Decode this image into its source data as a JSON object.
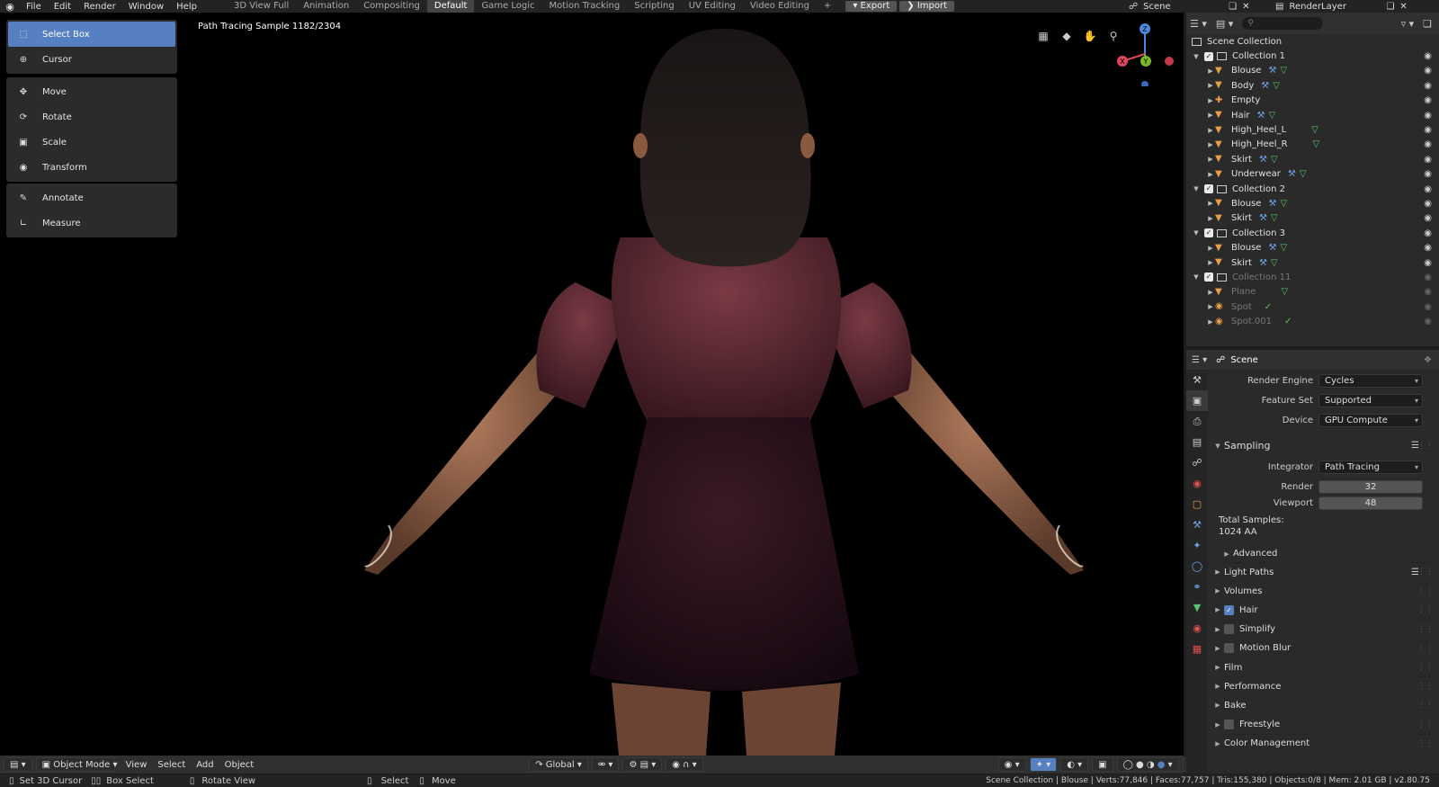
{
  "menu": [
    "File",
    "Edit",
    "Render",
    "Window",
    "Help"
  ],
  "workspaces": [
    "3D View Full",
    "Animation",
    "Compositing",
    "Default",
    "Game Logic",
    "Motion Tracking",
    "Scripting",
    "UV Editing",
    "Video Editing",
    "+"
  ],
  "active_workspace": "Default",
  "top_buttons": {
    "export": "Export",
    "import": "Import"
  },
  "scene_name": "Scene",
  "render_layer": "RenderLayer",
  "viewport": {
    "sample_label": "Path Tracing Sample 1182/2304"
  },
  "tools": [
    [
      {
        "label": "Select Box",
        "icon": "select-box-icon",
        "active": true
      },
      {
        "label": "Cursor",
        "icon": "cursor-icon"
      }
    ],
    [
      {
        "label": "Move",
        "icon": "move-icon"
      },
      {
        "label": "Rotate",
        "icon": "rotate-icon"
      },
      {
        "label": "Scale",
        "icon": "scale-icon"
      },
      {
        "label": "Transform",
        "icon": "transform-icon"
      }
    ],
    [
      {
        "label": "Annotate",
        "icon": "annotate-icon"
      },
      {
        "label": "Measure",
        "icon": "measure-icon"
      }
    ]
  ],
  "gizmo": {
    "z": "Z",
    "y": "Y",
    "x": "X"
  },
  "header_bottom": {
    "mode": "Object Mode",
    "menus": [
      "View",
      "Select",
      "Add",
      "Object"
    ],
    "transform": "Global"
  },
  "outliner": {
    "root": "Scene Collection",
    "rows": [
      {
        "name": "Collection 1",
        "type": "collection",
        "indent": 1
      },
      {
        "name": "Blouse",
        "type": "mesh",
        "indent": 2,
        "mod": true
      },
      {
        "name": "Body",
        "type": "mesh",
        "indent": 2,
        "mod": true
      },
      {
        "name": "Empty",
        "type": "empty",
        "indent": 2
      },
      {
        "name": "Hair",
        "type": "mesh",
        "indent": 2,
        "mod": true
      },
      {
        "name": "High_Heel_L",
        "type": "mesh",
        "indent": 2,
        "mod": false
      },
      {
        "name": "High_Heel_R",
        "type": "mesh",
        "indent": 2,
        "mod": false
      },
      {
        "name": "Skirt",
        "type": "mesh",
        "indent": 2,
        "mod": true
      },
      {
        "name": "Underwear",
        "type": "mesh",
        "indent": 2,
        "mod": true
      },
      {
        "name": "Collection 2",
        "type": "collection",
        "indent": 1
      },
      {
        "name": "Blouse",
        "type": "mesh",
        "indent": 2,
        "mod": true
      },
      {
        "name": "Skirt",
        "type": "mesh",
        "indent": 2,
        "mod": true
      },
      {
        "name": "Collection 3",
        "type": "collection",
        "indent": 1
      },
      {
        "name": "Blouse",
        "type": "mesh",
        "indent": 2,
        "mod": true
      },
      {
        "name": "Skirt",
        "type": "mesh",
        "indent": 2,
        "mod": true
      },
      {
        "name": "Collection 11",
        "type": "collection",
        "indent": 1,
        "dim": true
      },
      {
        "name": "Plane",
        "type": "mesh",
        "indent": 2,
        "dim": true
      },
      {
        "name": "Spot",
        "type": "light",
        "indent": 2,
        "dim": true
      },
      {
        "name": "Spot.001",
        "type": "light",
        "indent": 2,
        "dim": true
      }
    ]
  },
  "properties": {
    "context": "Scene",
    "render_engine": {
      "label": "Render Engine",
      "value": "Cycles"
    },
    "feature_set": {
      "label": "Feature Set",
      "value": "Supported"
    },
    "device": {
      "label": "Device",
      "value": "GPU Compute"
    },
    "sampling": {
      "title": "Sampling",
      "integrator_label": "Integrator",
      "integrator": "Path Tracing",
      "render_label": "Render",
      "render": "32",
      "viewport_label": "Viewport",
      "viewport": "48",
      "total_label": "Total Samples:",
      "total": "1024 AA",
      "advanced": "Advanced"
    },
    "panels": [
      {
        "title": "Light Paths"
      },
      {
        "title": "Volumes"
      },
      {
        "title": "Hair",
        "checkbox": true,
        "checked": true
      },
      {
        "title": "Simplify",
        "checkbox": true,
        "checked": false
      },
      {
        "title": "Motion Blur",
        "checkbox": true,
        "checked": false
      },
      {
        "title": "Film"
      },
      {
        "title": "Performance"
      },
      {
        "title": "Bake"
      },
      {
        "title": "Freestyle",
        "checkbox": true,
        "checked": false
      },
      {
        "title": "Color Management"
      }
    ]
  },
  "status": {
    "hint1": "Set 3D Cursor",
    "hint2": "Box Select",
    "hint3": "Rotate View",
    "hint4": "Select",
    "hint5": "Move",
    "info": "Scene Collection | Blouse | Verts:77,846 | Faces:77,757 | Tris:155,380 | Objects:0/8 | Mem: 2.01 GB | v2.80.75"
  },
  "colors": {
    "accent": "#5680c2",
    "mesh_icon": "#e79e47",
    "modifier_icon": "#6fa3e8",
    "data_icon": "#59c26a"
  }
}
